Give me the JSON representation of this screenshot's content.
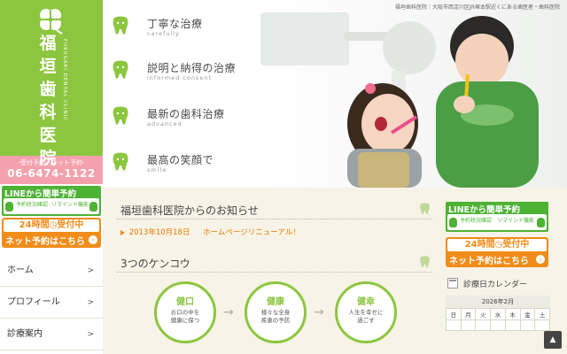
{
  "colors": {
    "brand_green": "#8cc63f",
    "accent_orange": "#f08c1a",
    "contact_pink": "#f4a1ad",
    "background": "#f7f3e6"
  },
  "logo": {
    "name_chars": [
      "福",
      "垣",
      "歯",
      "科",
      "医",
      "院"
    ],
    "roman": "FUKUGAKI DENTAL CLINIC"
  },
  "contact": {
    "label": "-受付予約・ネット予約-",
    "phone": "06-6474-1122"
  },
  "line_banner": {
    "title": "LINEから簡単予約",
    "sub_left": "予約状況確認",
    "sub_right": "リマインド機能"
  },
  "net_banner": {
    "top": "24時間◷受付中",
    "bottom": "ネット予約はこちら",
    "arrow": "›"
  },
  "nav": {
    "items": [
      {
        "label": "ホーム",
        "arrow": ">"
      },
      {
        "label": "プロフィール",
        "arrow": ">"
      },
      {
        "label": "診療案内",
        "arrow": ">"
      }
    ]
  },
  "hero": {
    "caption": "福垣歯科医院｜大阪市西淀川区JR塚本駅近くにある歯医者・歯科医院",
    "features": [
      {
        "title": "丁寧な治療",
        "sub": "carefully"
      },
      {
        "title": "説明と納得の治療",
        "sub": "informed consent"
      },
      {
        "title": "最新の歯科治療",
        "sub": "advanced"
      },
      {
        "title": "最高の笑顔で",
        "sub": "smile"
      }
    ]
  },
  "news": {
    "heading": "福垣歯科医院からのお知らせ",
    "items": [
      {
        "date": "2013年10月18日",
        "text": "ホームページリニューアル！"
      }
    ]
  },
  "kenkou": {
    "heading": "3つのケンコウ",
    "circles": [
      {
        "title": "健口",
        "desc_line1": "お口の中を",
        "desc_line2": "健康に保つ"
      },
      {
        "title": "健康",
        "desc_line1": "様々な全身",
        "desc_line2": "疾患の予防"
      },
      {
        "title": "健幸",
        "desc_line1": "人生を幸せに",
        "desc_line2": "過ごす"
      }
    ]
  },
  "calendar": {
    "heading": "診療日カレンダー",
    "month": "2026年2月",
    "weekdays": [
      "日",
      "月",
      "火",
      "水",
      "木",
      "金",
      "土"
    ]
  },
  "to_top": "▲"
}
